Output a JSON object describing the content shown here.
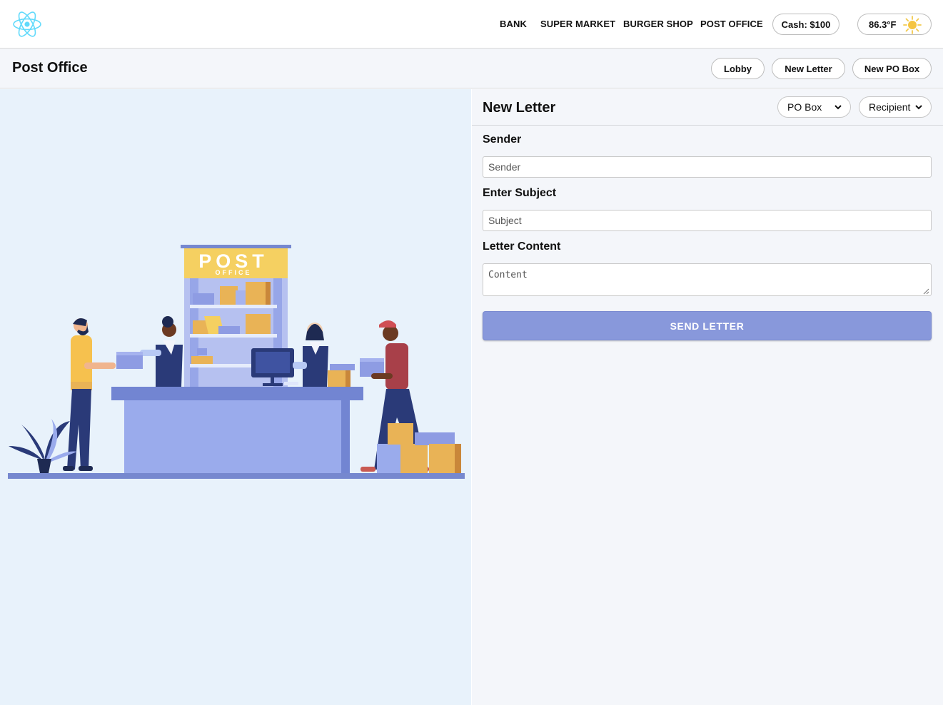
{
  "nav": {
    "links": [
      "BANK",
      "SUPER MARKET",
      "BURGER SHOP",
      "POST OFFICE"
    ],
    "cash": "Cash: $100",
    "temperature": "86.3°F"
  },
  "subheader": {
    "title": "Post Office",
    "buttons": [
      "Lobby",
      "New Letter",
      "New PO Box"
    ]
  },
  "illustration": {
    "sign_main": "POST",
    "sign_sub": "OFFICE"
  },
  "form": {
    "title": "New Letter",
    "po_box_select": "PO Box",
    "recipient_select": "Recipient",
    "sender_label": "Sender",
    "sender_placeholder": "Sender",
    "subject_label": "Enter Subject",
    "subject_placeholder": "Subject",
    "content_label": "Letter Content",
    "content_placeholder": "Content",
    "send_button": "SEND LETTER"
  },
  "colors": {
    "accent": "#8898db",
    "illustration_bg": "#e8f2fb",
    "panel_bg": "#f4f6fa",
    "logo": "#61dafb"
  }
}
